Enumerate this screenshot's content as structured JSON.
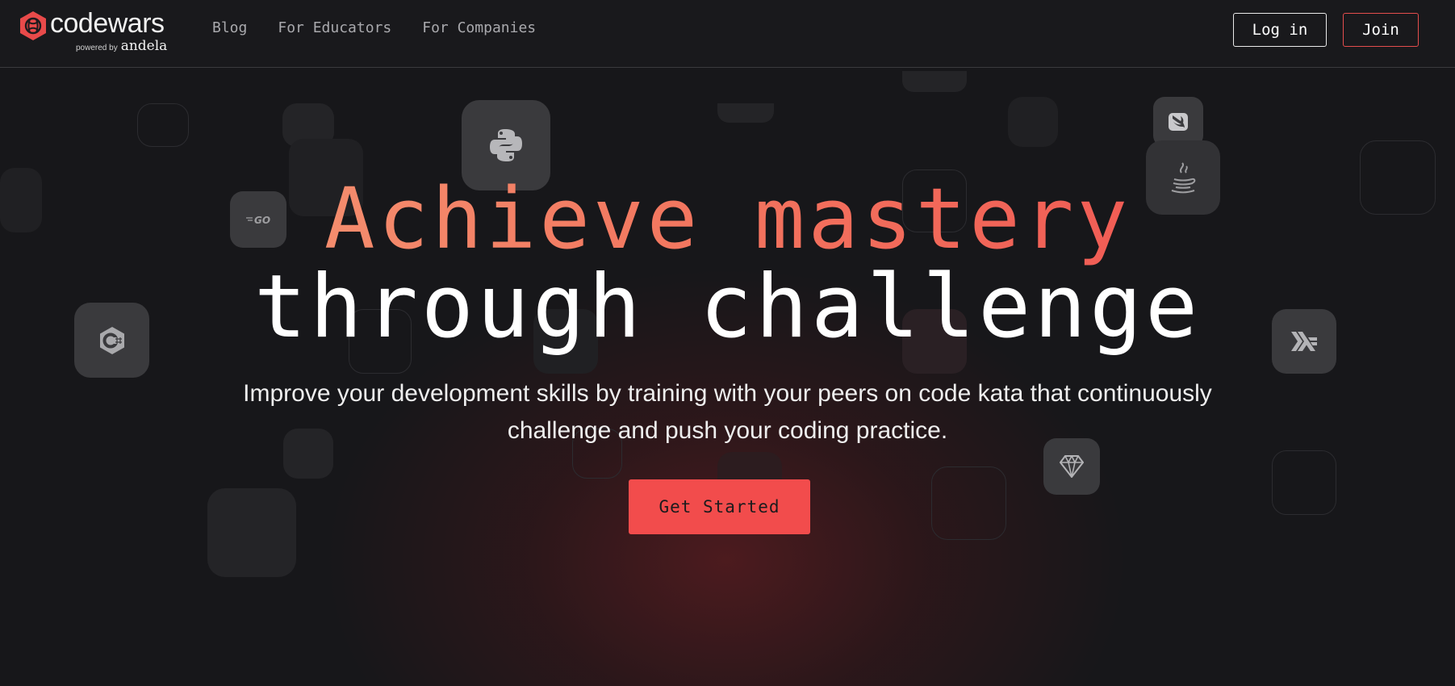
{
  "header": {
    "logo_text": "codewars",
    "logo_powered_by": "powered by",
    "logo_brand": "andela",
    "nav": [
      "Blog",
      "For Educators",
      "For Companies"
    ],
    "login_label": "Log in",
    "join_label": "Join"
  },
  "hero": {
    "title_line1": "Achieve mastery",
    "title_line2": "through challenge",
    "subtitle": "Improve your development skills by training with your peers on code kata that continuously challenge and push your coding practice.",
    "cta_label": "Get Started"
  },
  "icons": [
    "codewars-logo-icon",
    "python-icon",
    "go-icon",
    "csharp-icon",
    "java-icon",
    "swift-icon",
    "haskell-icon",
    "ruby-icon"
  ],
  "colors": {
    "background": "#17171a",
    "accent_red": "#f24c4c",
    "gradient_start": "#f7a07a",
    "gradient_end": "#f04a4d",
    "tile": "#3a3a3d"
  }
}
